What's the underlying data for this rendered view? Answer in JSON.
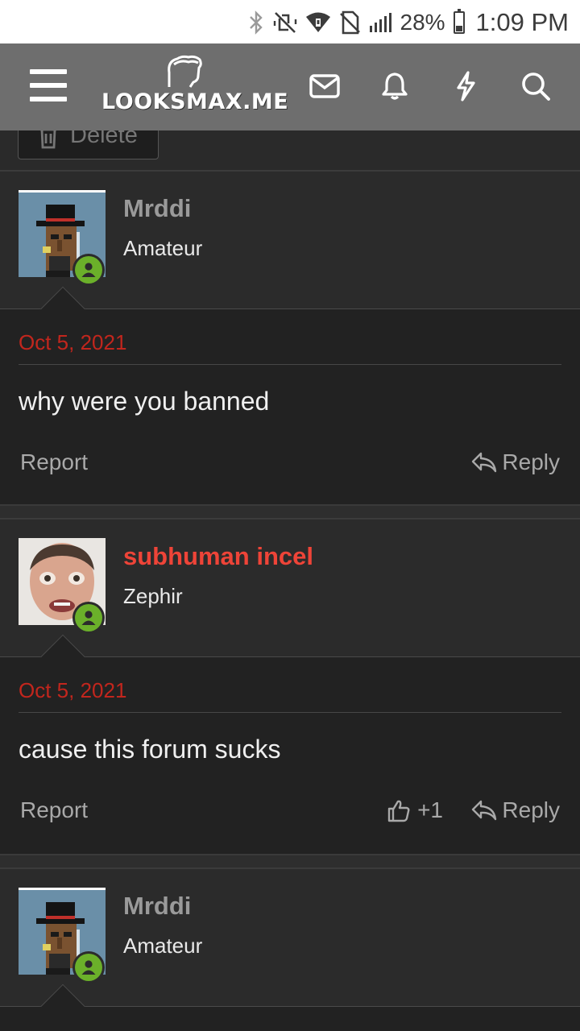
{
  "status_bar": {
    "battery_percent": "28%",
    "battery_level": 0.28,
    "time": "1:09 PM",
    "icons": [
      "bluetooth-icon",
      "vibrate-off-icon",
      "wifi-icon",
      "no-sim-icon",
      "signal-icon"
    ]
  },
  "header": {
    "logo_text": "LOOKSMAX.ME",
    "icons": [
      "menu-icon",
      "mail-icon",
      "bell-icon",
      "bolt-icon",
      "search-icon"
    ]
  },
  "prev_post": {
    "delete_label": "Delete"
  },
  "colors": {
    "accent_red": "#ee4438",
    "date_red": "#c2261d",
    "online_green": "#6bb02a",
    "header_gray": "#6e6e6e"
  },
  "posts": [
    {
      "username": "Mrddi",
      "user_title": "Amateur",
      "date": "Oct 5, 2021",
      "text": "why were you banned",
      "report_label": "Report",
      "reply_label": "Reply"
    },
    {
      "username": "subhuman incel",
      "user_title": "Zephir",
      "date": "Oct 5, 2021",
      "text": "cause this forum sucks",
      "report_label": "Report",
      "reply_label": "Reply",
      "likes": "+1"
    },
    {
      "username": "Mrddi",
      "user_title": "Amateur"
    }
  ]
}
